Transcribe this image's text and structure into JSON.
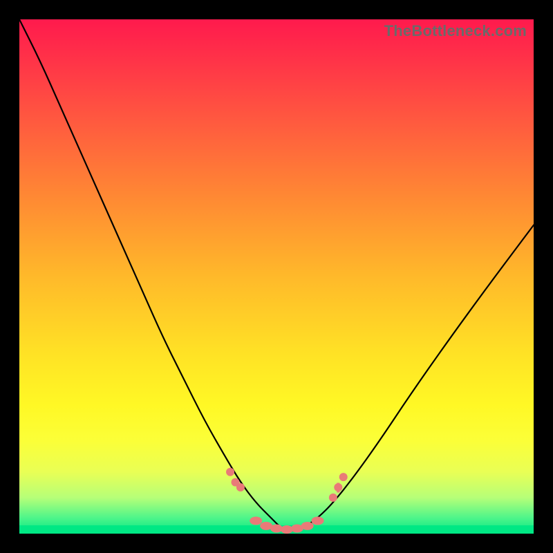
{
  "watermark": "TheBottleneck.com",
  "colors": {
    "background_black": "#000000",
    "gradient_top": "#ff1a4d",
    "gradient_bottom": "#00e884",
    "curve": "#000000",
    "marker_fill": "#e97a78"
  },
  "chart_data": {
    "type": "line",
    "title": "",
    "xlabel": "",
    "ylabel": "",
    "xlim": [
      0,
      100
    ],
    "ylim": [
      0,
      100
    ],
    "series": [
      {
        "name": "bottleneck-curve",
        "x": [
          0,
          4,
          8,
          12,
          16,
          20,
          24,
          28,
          32,
          36,
          40,
          43,
          46,
          49,
          51,
          53,
          55,
          58,
          61,
          65,
          70,
          76,
          83,
          91,
          100
        ],
        "y": [
          100,
          92,
          83,
          74,
          65,
          56,
          47,
          38,
          30,
          22,
          15,
          10,
          6,
          3,
          1,
          0.5,
          1,
          3,
          6,
          11,
          18,
          27,
          37,
          48,
          60
        ]
      }
    ],
    "annotations": {
      "left_marker_cluster_x": [
        41,
        42,
        43
      ],
      "left_marker_cluster_y": [
        12,
        10,
        9
      ],
      "floor_marker_x": [
        46,
        48,
        50,
        52,
        54,
        56,
        58
      ],
      "floor_marker_y": [
        2.5,
        1.5,
        1,
        0.8,
        1,
        1.5,
        2.5
      ],
      "right_marker_cluster_x": [
        61,
        62,
        63
      ],
      "right_marker_cluster_y": [
        7,
        9,
        11
      ],
      "right_tick_x": 62,
      "right_tick_y": 8
    }
  }
}
